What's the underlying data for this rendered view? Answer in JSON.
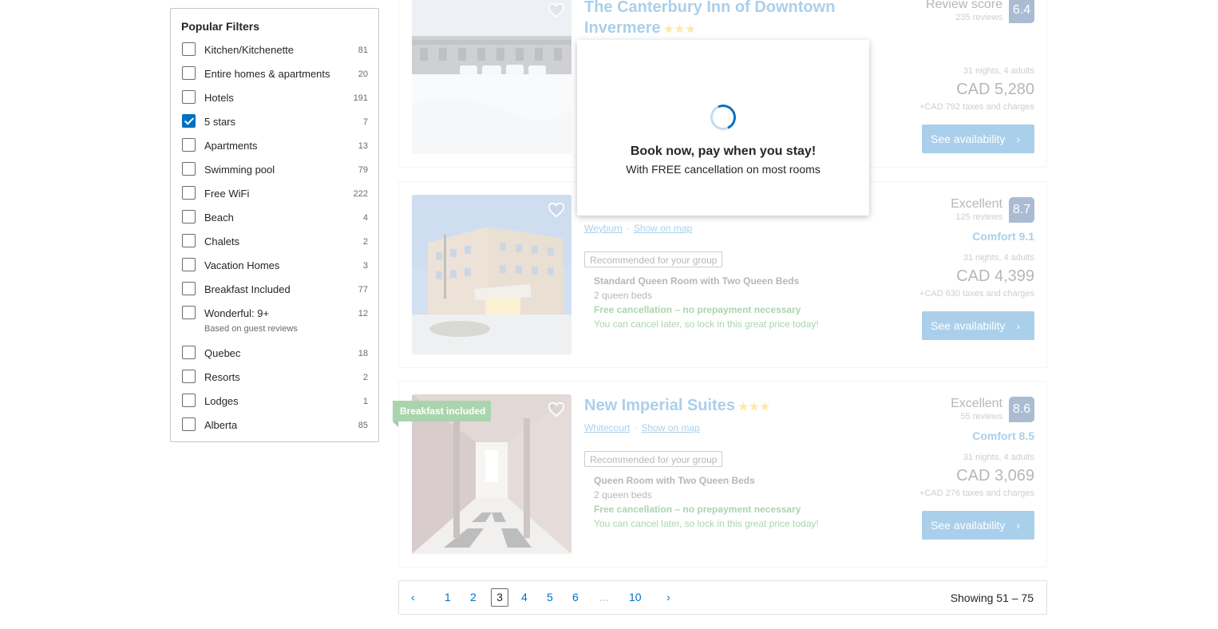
{
  "filters": {
    "title": "Popular Filters",
    "items": [
      {
        "label": "Kitchen/Kitchenette",
        "count": "81",
        "checked": false
      },
      {
        "label": "Entire homes & apartments",
        "count": "20",
        "checked": false
      },
      {
        "label": "Hotels",
        "count": "191",
        "checked": false
      },
      {
        "label": "5 stars",
        "count": "7",
        "checked": true
      },
      {
        "label": "Apartments",
        "count": "13",
        "checked": false
      },
      {
        "label": "Swimming pool",
        "count": "79",
        "checked": false
      },
      {
        "label": "Free WiFi",
        "count": "222",
        "checked": false
      },
      {
        "label": "Beach",
        "count": "4",
        "checked": false
      },
      {
        "label": "Chalets",
        "count": "2",
        "checked": false
      },
      {
        "label": "Vacation Homes",
        "count": "3",
        "checked": false
      },
      {
        "label": "Breakfast Included",
        "count": "77",
        "checked": false
      },
      {
        "label": "Wonderful: 9+",
        "count": "12",
        "checked": false,
        "sub": "Based on guest reviews"
      },
      {
        "label": "Quebec",
        "count": "18",
        "checked": false
      },
      {
        "label": "Resorts",
        "count": "2",
        "checked": false
      },
      {
        "label": "Lodges",
        "count": "1",
        "checked": false
      },
      {
        "label": "Alberta",
        "count": "85",
        "checked": false
      }
    ]
  },
  "hotels": [
    {
      "name_line1": "The Canterbury Inn of Downtown",
      "name_line2": "Invermere",
      "stars": "★★★",
      "review_word": "Review score",
      "review_count": "235 reviews",
      "score": "6.4",
      "nights": "31 nights, 4 adults",
      "price": "CAD 5,280",
      "taxes": "+CAD 792 taxes and charges",
      "button": "See availability"
    },
    {
      "location": "Weyburn",
      "map_link": "Show on map",
      "recommended": "Recommended for your group",
      "room": "Standard Queen Room with Two Queen Beds",
      "beds": "2 queen beds",
      "free_cancel": "Free cancellation – no prepayment necessary",
      "cancel_later": "You can cancel later, so lock in this great price today!",
      "review_word": "Excellent",
      "review_count": "125 reviews",
      "score": "8.7",
      "comfort": "Comfort 9.1",
      "nights": "31 nights, 4 adults",
      "price": "CAD 4,399",
      "taxes": "+CAD 630 taxes and charges",
      "button": "See availability"
    },
    {
      "ribbon": "Breakfast included",
      "name": "New Imperial Suites",
      "stars": "★★★",
      "location": "Whitecourt",
      "map_link": "Show on map",
      "recommended": "Recommended for your group",
      "room": "Queen Room with Two Queen Beds",
      "beds": "2 queen beds",
      "free_cancel": "Free cancellation – no prepayment necessary",
      "cancel_later": "You can cancel later, so lock in this great price today!",
      "review_word": "Excellent",
      "review_count": "55 reviews",
      "score": "8.6",
      "comfort": "Comfort 8.5",
      "nights": "31 nights, 4 adults",
      "price": "CAD 3,069",
      "taxes": "+CAD 276 taxes and charges",
      "button": "See availability"
    }
  ],
  "overlay": {
    "title": "Book now, pay when you stay!",
    "subtitle": "With FREE cancellation on most rooms"
  },
  "pagination": {
    "prev": "‹",
    "pages": [
      "1",
      "2",
      "3",
      "4",
      "5",
      "6"
    ],
    "current": "3",
    "ellipsis": "...",
    "last": "10",
    "next": "›",
    "showing": "Showing 51 – 75"
  },
  "colors": {
    "brand_blue": "#0071c2",
    "score_navy": "#003580",
    "green": "#008009",
    "stars": "#febb02"
  }
}
